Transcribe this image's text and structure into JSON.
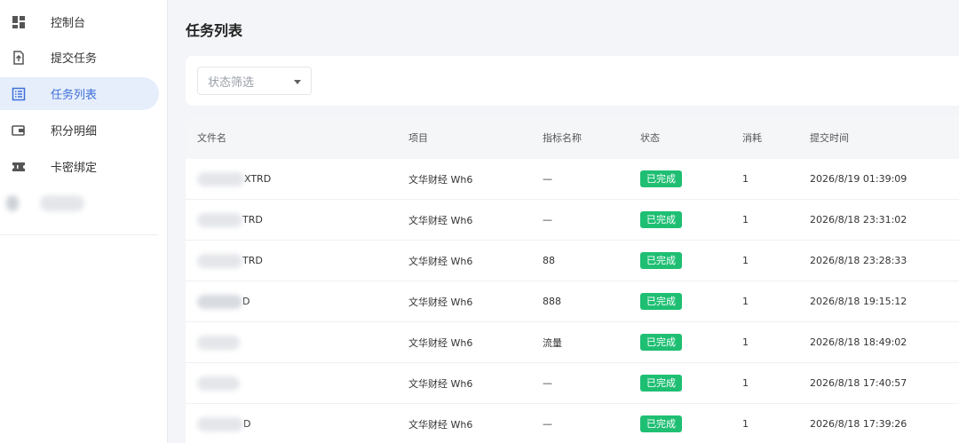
{
  "sidebar": {
    "items": [
      {
        "label": "控制台",
        "icon": "dashboard-icon"
      },
      {
        "label": "提交任务",
        "icon": "upload-file-icon"
      },
      {
        "label": "任务列表",
        "icon": "list-icon",
        "active": true
      },
      {
        "label": "积分明细",
        "icon": "wallet-icon"
      },
      {
        "label": "卡密绑定",
        "icon": "ticket-icon"
      }
    ]
  },
  "page": {
    "title": "任务列表"
  },
  "filter": {
    "status_placeholder": "状态筛选"
  },
  "table": {
    "columns": [
      "文件名",
      "项目",
      "指标名称",
      "状态",
      "消耗",
      "提交时间"
    ],
    "rows": [
      {
        "file": "XTRD",
        "project": "文华财经 Wh6",
        "metric": "—",
        "status": "已完成",
        "cost": "1",
        "time": "2026/8/19 01:39:09"
      },
      {
        "file": "TRD",
        "project": "文华财经 Wh6",
        "metric": "—",
        "status": "已完成",
        "cost": "1",
        "time": "2026/8/18 23:31:02"
      },
      {
        "file": "TRD",
        "project": "文华财经 Wh6",
        "metric": "88",
        "status": "已完成",
        "cost": "1",
        "time": "2026/8/18 23:28:33"
      },
      {
        "file": "D",
        "project": "文华财经 Wh6",
        "metric": "888",
        "status": "已完成",
        "cost": "1",
        "time": "2026/8/18 19:15:12"
      },
      {
        "file": "",
        "project": "文华财经 Wh6",
        "metric": "流量",
        "status": "已完成",
        "cost": "1",
        "time": "2026/8/18 18:49:02"
      },
      {
        "file": "",
        "project": "文华财经 Wh6",
        "metric": "—",
        "status": "已完成",
        "cost": "1",
        "time": "2026/8/18 17:40:57"
      },
      {
        "file": "D",
        "project": "文华财经 Wh6",
        "metric": "—",
        "status": "已完成",
        "cost": "1",
        "time": "2026/8/18 17:39:26"
      }
    ]
  },
  "colors": {
    "accent": "#3f6fd8",
    "active_bg": "#e6eefc",
    "success": "#1fbf73"
  }
}
